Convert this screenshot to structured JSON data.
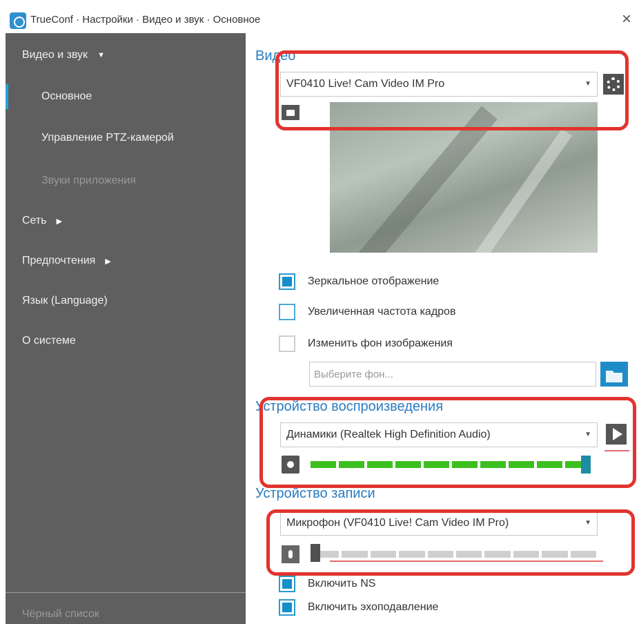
{
  "window": {
    "title": "TrueConf · Настройки · Видео и звук · Основное",
    "close_glyph": "×"
  },
  "sidebar": {
    "items": [
      {
        "label": "Видео и звук",
        "arrow": "▼"
      },
      {
        "label": "Основное"
      },
      {
        "label": "Управление PTZ-камерой"
      },
      {
        "label": "Звуки приложения"
      },
      {
        "label": "Сеть",
        "arrow": "▶"
      },
      {
        "label": "Предпочтения",
        "arrow": "▶"
      },
      {
        "label": "Язык (Language)"
      },
      {
        "label": "О системе"
      }
    ],
    "footer": "Чёрный список"
  },
  "video": {
    "section_title": "Видео",
    "camera_value": "VF0410 Live! Cam Video IM Pro",
    "mirror_label": "Зеркальное отображение",
    "mirror_checked": true,
    "hfr_label": "Увеличенная частота кадров",
    "hfr_checked": false,
    "bg_label": "Изменить фон изображения",
    "bg_checked": false,
    "bg_placeholder": "Выберите фон..."
  },
  "playback": {
    "section_title": "Устройство воспроизведения",
    "device_value": "Динамики (Realtek High Definition Audio)",
    "volume_level": 1.0,
    "meter_color": "#3cbf1f"
  },
  "recording": {
    "section_title": "Устройство записи",
    "device_value": "Микрофон (VF0410 Live! Cam Video IM Pro)",
    "level": 0.0,
    "meter_color": "#cfcfcf"
  },
  "options": {
    "ns_label": "Включить NS",
    "ns_checked": true,
    "echo_label": "Включить эхоподавление",
    "echo_checked": true
  },
  "colors": {
    "accent": "#25a4d8",
    "sidebar_bg": "#5f5f5f",
    "section_title": "#2a7cc0",
    "highlight": "#e1342f"
  },
  "icons": [
    "app-logo-icon",
    "close-icon",
    "gear-icon",
    "camera-icon",
    "folder-icon",
    "play-icon",
    "speaker-icon",
    "microphone-icon"
  ]
}
